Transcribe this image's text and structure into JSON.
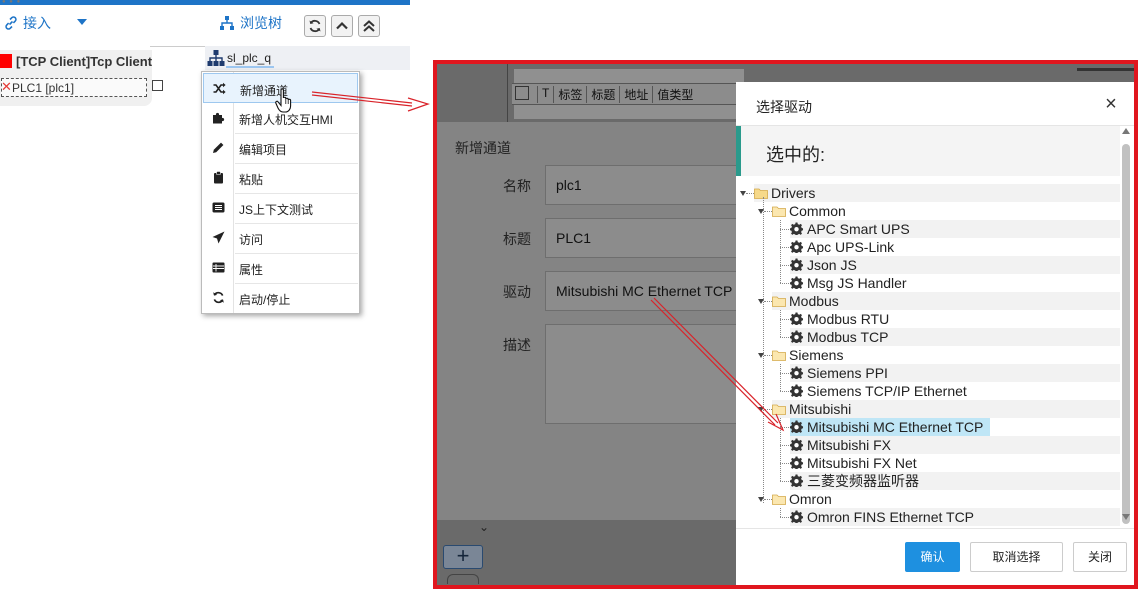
{
  "toolbar": {
    "import_label": "接入",
    "browse_label": "浏览树"
  },
  "tree_panel": {
    "root_label": "sl_plc_q"
  },
  "channel": {
    "title": "[TCP Client]Tcp Client",
    "device_label": "PLC1 [plc1]"
  },
  "context_menu": {
    "items": [
      {
        "label": "新增通道",
        "icon": "shuffle-icon"
      },
      {
        "label": "新增人机交互HMI",
        "icon": "puzzle-icon"
      },
      {
        "label": "编辑项目",
        "icon": "pencil-icon"
      },
      {
        "label": "粘贴",
        "icon": "clipboard-icon"
      },
      {
        "label": "JS上下文测试",
        "icon": "list-icon"
      },
      {
        "label": "访问",
        "icon": "send-icon"
      },
      {
        "label": "属性",
        "icon": "table-icon"
      },
      {
        "label": "启动/停止",
        "icon": "refresh-icon"
      }
    ]
  },
  "background_grid": {
    "headers": [
      "T",
      "标签",
      "标题",
      "地址",
      "值类型"
    ]
  },
  "new_channel_form": {
    "title": "新增通道",
    "name_label": "名称",
    "name_value": "plc1",
    "caption_label": "标题",
    "caption_value": "PLC1",
    "driver_label": "驱动",
    "driver_value": "Mitsubishi MC Ethernet TCP",
    "desc_label": "描述",
    "add_button": "+"
  },
  "driver_dialog": {
    "title": "选择驱动",
    "close_glyph": "×",
    "selected_label": "选中的:",
    "tree": {
      "root": "Drivers",
      "groups": [
        {
          "name": "Common",
          "items": [
            "APC Smart UPS",
            "Apc UPS-Link",
            "Json JS",
            "Msg JS Handler"
          ]
        },
        {
          "name": "Modbus",
          "items": [
            "Modbus RTU",
            "Modbus TCP"
          ]
        },
        {
          "name": "Siemens",
          "items": [
            "Siemens PPI",
            "Siemens TCP/IP Ethernet"
          ]
        },
        {
          "name": "Mitsubishi",
          "items": [
            "Mitsubishi MC Ethernet TCP",
            "Mitsubishi FX",
            "Mitsubishi FX Net",
            "三菱变频器监听器"
          ]
        },
        {
          "name": "Omron",
          "items": [
            "Omron FINS Ethernet TCP"
          ]
        }
      ],
      "selected_item": "Mitsubishi MC Ethernet TCP"
    },
    "buttons": {
      "ok": "确认",
      "clear": "取消选择",
      "close": "关闭"
    }
  },
  "colors": {
    "accent": "#1e74c7",
    "frame_red": "#e0161e",
    "ok_button": "#1e90e0",
    "selection": "#bfe6f6",
    "teal_bar": "#2a9a8c"
  }
}
